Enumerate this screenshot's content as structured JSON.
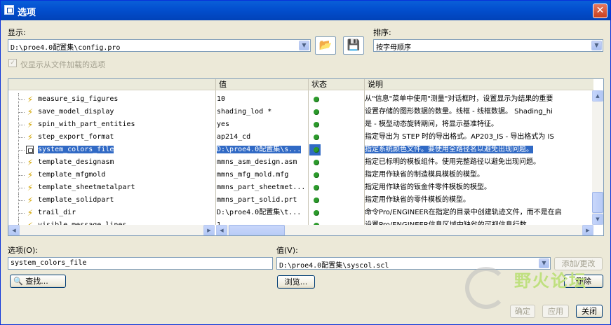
{
  "window": {
    "title": "选项",
    "close_glyph": "✕"
  },
  "display": {
    "label": "显示:",
    "value": "D:\\proe4.0配置集\\config.pro",
    "open_icon": "folder-open-icon",
    "save_icon": "save-config-icon"
  },
  "sort": {
    "label": "排序:",
    "value": "按字母顺序"
  },
  "loaded_only": {
    "label": "仅显示从文件加载的选项",
    "checked": true
  },
  "table": {
    "headers": {
      "value": "值",
      "status": "状态",
      "desc": "说明"
    },
    "rows": [
      {
        "name": "measure_sig_figures",
        "value": "10",
        "icon": "lightning-icon",
        "desc": "从\"信息\"菜单中使用\"测量\"对话框时，设置显示为结果的重要"
      },
      {
        "name": "save_model_display",
        "value": "shading_lod *",
        "icon": "lightning-icon",
        "desc": "设置存储的图形数据的数量。线框 - 线框数据。 Shading_hi"
      },
      {
        "name": "spin_with_part_entities",
        "value": "yes",
        "icon": "lightning-icon",
        "desc": "是 - 模型动态旋转期间，将显示基准特征。"
      },
      {
        "name": "step_export_format",
        "value": "ap214_cd",
        "icon": "lightning-icon",
        "desc": "指定导出为 STEP 时的导出格式。AP203_IS - 导出格式为 IS"
      },
      {
        "name": "system_colors_file",
        "value": "D:\\proe4.0配置集\\s...",
        "icon": "file-icon",
        "desc": "指定系统颜色文件。要使用全路径名以避免出现问题。",
        "selected": true
      },
      {
        "name": "template_designasm",
        "value": "mmns_asm_design.asm",
        "icon": "lightning-icon",
        "desc": "指定已标明的模板组件。使用完整路径以避免出现问题。"
      },
      {
        "name": "template_mfgmold",
        "value": "mmns_mfg_mold.mfg",
        "icon": "lightning-icon",
        "desc": "指定用作缺省的制造模具模板的模型。"
      },
      {
        "name": "template_sheetmetalpart",
        "value": "mmns_part_sheetmet...",
        "icon": "lightning-icon",
        "desc": "指定用作缺省的钣金件零件模板的模型。"
      },
      {
        "name": "template_solidpart",
        "value": "mmns_part_solid.prt",
        "icon": "lightning-icon",
        "desc": "指定用作缺省的零件模板的模型。"
      },
      {
        "name": "trail_dir",
        "value": "D:\\proe4.0配置集\\t...",
        "icon": "lightning-icon",
        "desc": "命令Pro/ENGINEER在指定的目录中创建轨迹文件，而不是在启"
      },
      {
        "name": "visible_message_lines",
        "value": "1",
        "icon": "lightning-icon",
        "desc": "设置Pro/ENGINEER信息区域中缺省的可视信息行数"
      }
    ]
  },
  "option_field": {
    "label": "选项(O):",
    "value": "system_colors_file"
  },
  "value_field": {
    "label": "值(V):",
    "value": "D:\\proe4.0配置集\\syscol.scl"
  },
  "buttons": {
    "add_change": "添加/更改",
    "find": "查找...",
    "browse": "浏览...",
    "delete": "删除",
    "ok": "确定",
    "apply": "应用",
    "close": "关闭"
  },
  "watermark": {
    "text": "野火论坛"
  }
}
